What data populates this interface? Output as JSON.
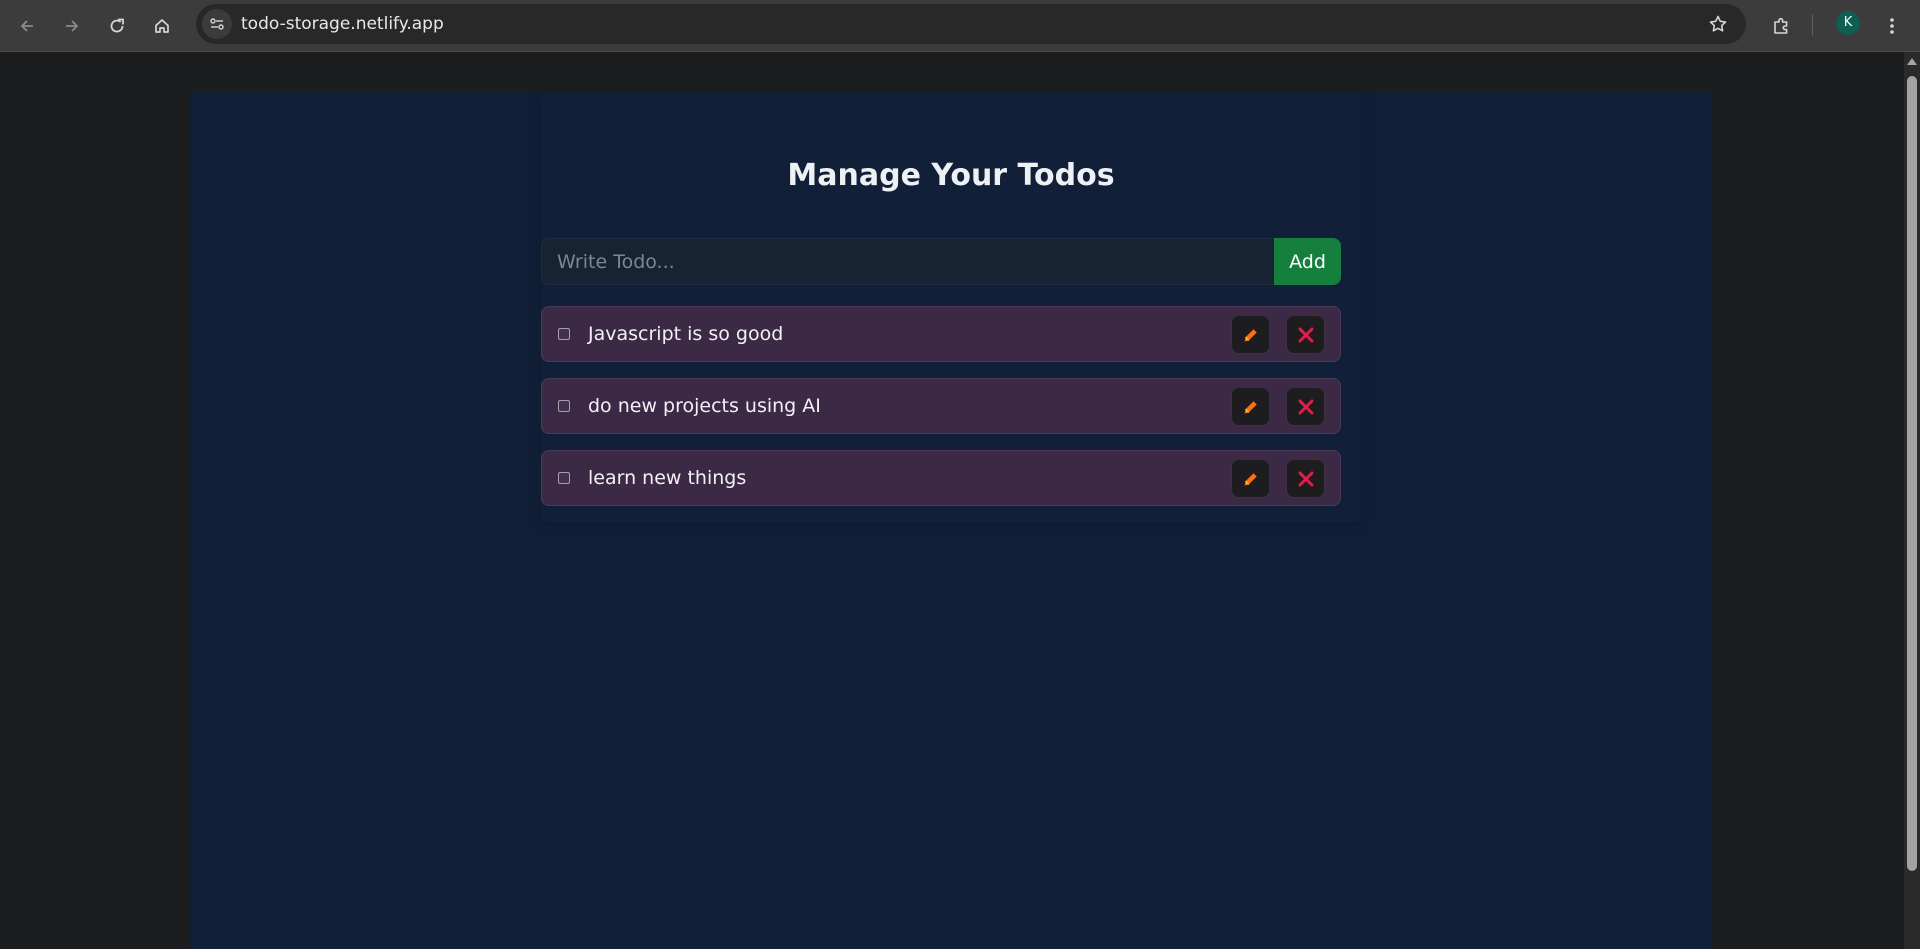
{
  "browser": {
    "url": "todo-storage.netlify.app",
    "profile_initial": "K",
    "icons": [
      "back-icon",
      "forward-icon",
      "reload-icon",
      "home-icon",
      "site-info-icon",
      "star-icon",
      "extensions-icon",
      "menu-icon"
    ]
  },
  "app": {
    "title": "Manage Your Todos",
    "input_placeholder": "Write Todo...",
    "add_label": "Add",
    "todos": [
      {
        "text": "Javascript is so good",
        "completed": false
      },
      {
        "text": "do new projects using AI",
        "completed": false
      },
      {
        "text": "learn new things",
        "completed": false
      }
    ],
    "icons": {
      "edit": "pencil-icon",
      "delete": "close-icon"
    }
  },
  "colors": {
    "page_background": "#112038",
    "todo_background": "#3b2945",
    "add_button": "#15803d",
    "edit_icon": "#f97316",
    "delete_icon": "#e11d48"
  }
}
